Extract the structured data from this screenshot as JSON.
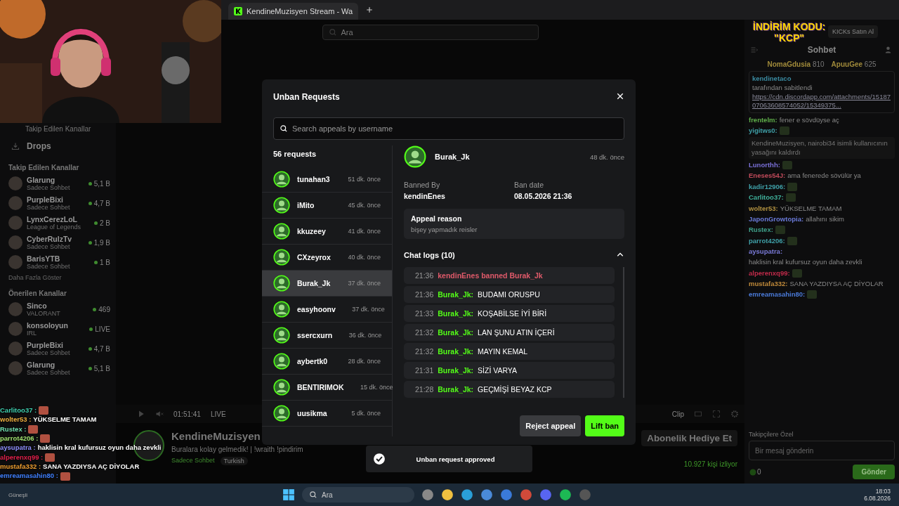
{
  "browser": {
    "tab_title": "KendineMuzisyen Stream - Wa"
  },
  "sidebar": {
    "top_header": "Takip Edilen Kanallar",
    "drops": "Drops",
    "sections": [
      {
        "title": "Takip Edilen Kanallar",
        "channels": [
          {
            "name": "Glarung",
            "category": "Sadece Sohbet",
            "viewers": "5,1 B"
          },
          {
            "name": "PurpleBixi",
            "category": "Sadece Sohbet",
            "viewers": "4,7 B"
          },
          {
            "name": "LynxCerezLoL",
            "category": "League of Legends",
            "viewers": "2 B"
          },
          {
            "name": "CyberRulzTv",
            "category": "Sadece Sohbet",
            "viewers": "1,9 B"
          },
          {
            "name": "BarisYTB",
            "category": "Sadece Sohbet",
            "viewers": "1 B"
          }
        ],
        "more": "Daha Fazla Göster"
      },
      {
        "title": "Önerilen Kanallar",
        "channels": [
          {
            "name": "Sinco",
            "category": "VALORANT",
            "viewers": "469"
          },
          {
            "name": "konsoloyun",
            "category": "IRL",
            "viewers": "LIVE"
          },
          {
            "name": "PurpleBixi",
            "category": "Sadece Sohbet",
            "viewers": "4,7 B"
          },
          {
            "name": "Glarung",
            "category": "Sadece Sohbet",
            "viewers": "5,1 B"
          }
        ]
      }
    ]
  },
  "stream": {
    "search_placeholder": "Ara",
    "kicks_button": "KICKs Satın Al",
    "elapsed": "01:51:41",
    "live": "LIVE",
    "clip": "Clip",
    "streamer": "KendineMuzisyen",
    "title": "Buralara kolay gelmedik! | !wraith !pindirim",
    "tags": [
      "Sadece Sohbet",
      "Turkish"
    ],
    "viewers": "10.927 kişi izliyor",
    "gift": "Abonelik Hediye Et"
  },
  "promo": {
    "line1": "İNDİRİM KODU:",
    "line2": "\"KCP\""
  },
  "chat": {
    "title": "Sohbet",
    "gifters": [
      {
        "name": "NomaGdusia",
        "count": "810"
      },
      {
        "name": "ApuuGee",
        "count": "625"
      }
    ],
    "pinned": {
      "user": "kendinetaco",
      "note": "tarafından sabitlendi",
      "link": "https://cdn.discordapp.com/attachments/1518707063608574052/15349375..."
    },
    "messages": [
      {
        "kind": "text",
        "user": "frentelm:",
        "color": "#5faf4a",
        "text": "fener e sövdüyse aç"
      },
      {
        "kind": "emote",
        "user": "yigitws0:",
        "color": "#3fa0a8"
      },
      {
        "kind": "system",
        "text": "KendineMuzisyen, nairobi34 isimli kullanıcının yasağını kaldırdı"
      },
      {
        "kind": "emote",
        "user": "Lunorthh:",
        "color": "#7a70d8"
      },
      {
        "kind": "text",
        "user": "Eneses54J:",
        "color": "#c04a5a",
        "text": "ama fenerede sövülür ya"
      },
      {
        "kind": "emote",
        "user": "kadir12906:",
        "color": "#3fa0a8"
      },
      {
        "kind": "emote",
        "user": "Carlitoo37:",
        "color": "#3fb09a"
      },
      {
        "kind": "text",
        "user": "wolter53:",
        "color": "#b09040",
        "text": "YÜKSELME TAMAM"
      },
      {
        "kind": "text",
        "user": "JaponGrowtopia:",
        "color": "#6a7ad8",
        "text": "allahını sikim"
      },
      {
        "kind": "emote",
        "user": "Rustex:",
        "color": "#3fa08a"
      },
      {
        "kind": "emote",
        "user": "parrot4206:",
        "color": "#3fa0a8"
      },
      {
        "kind": "text",
        "user": "aysupatra:",
        "color": "#7a7ad8",
        "text": "haklisin kral kufursuz oyun daha zevkli"
      },
      {
        "kind": "emote",
        "user": "alperenxq99:",
        "color": "#c02a4a"
      },
      {
        "kind": "text",
        "user": "mustafa332:",
        "color": "#c08a3a",
        "text": "SANA YAZDIYSA AÇ DİYOLAR"
      },
      {
        "kind": "emote",
        "user": "emreamasahin80:",
        "color": "#4a7ad8"
      }
    ],
    "followers_label": "Takipçilere Özel",
    "input_placeholder": "Bir mesaj gönderin",
    "kicks_count": "0",
    "send": "Gönder"
  },
  "overlay_chat": [
    {
      "kind": "emote",
      "user": "Carlitoo37 :",
      "color": "#3fd0b0"
    },
    {
      "kind": "text",
      "user": "wolter53 :",
      "color": "#f0b040",
      "text": "YÜKSELME TAMAM"
    },
    {
      "kind": "emote",
      "user": "Rustex :",
      "color": "#70e0b0"
    },
    {
      "kind": "emote",
      "user": "parrot4206 :",
      "color": "#a0e070"
    },
    {
      "kind": "text",
      "user": "aysupatra :",
      "color": "#9090ff",
      "text": "haklisin kral kufursuz oyun daha zevkli"
    },
    {
      "kind": "emote",
      "user": "alperenxq99 :",
      "color": "#e0204a"
    },
    {
      "kind": "text",
      "user": "mustafa332 :",
      "color": "#f0a030",
      "text": "SANA YAZDIYSA AÇ DİYOLAR"
    },
    {
      "kind": "emote",
      "user": "emreamasahin80 :",
      "color": "#4080ff"
    }
  ],
  "modal": {
    "title": "Unban Requests",
    "search_placeholder": "Search appeals by username",
    "count": "56 requests",
    "requests": [
      {
        "user": "tunahan3",
        "time": "51 dk. önce",
        "selected": false
      },
      {
        "user": "iMito",
        "time": "45 dk. önce",
        "selected": false
      },
      {
        "user": "kkuzeey",
        "time": "41 dk. önce",
        "selected": false
      },
      {
        "user": "CXzeyrox",
        "time": "40 dk. önce",
        "selected": false
      },
      {
        "user": "Burak_Jk",
        "time": "37 dk. önce",
        "selected": true
      },
      {
        "user": "easyhoonv",
        "time": "37 dk. önce",
        "selected": false
      },
      {
        "user": "ssercxurn",
        "time": "36 dk. önce",
        "selected": false
      },
      {
        "user": "aybertk0",
        "time": "28 dk. önce",
        "selected": false
      },
      {
        "user": "BENTIRIMOK",
        "time": "15 dk. önce",
        "selected": false
      },
      {
        "user": "uusikma",
        "time": "5 dk. önce",
        "selected": false
      }
    ],
    "detail": {
      "user": "Burak_Jk",
      "time": "48 dk. önce",
      "banned_by_label": "Banned By",
      "banned_by": "kendinEnes",
      "ban_date_label": "Ban date",
      "ban_date": "08.05.2026 21:36",
      "reason_label": "Appeal reason",
      "reason": "bişey yapmadık reisler",
      "logs_title": "Chat logs (10)",
      "logs_expanded": true,
      "logs": [
        {
          "kind": "ban",
          "time": "21:36",
          "text": "kendinEnes banned Burak_Jk"
        },
        {
          "kind": "message",
          "time": "21:36",
          "user": "Burak_Jk:",
          "text": "BUDAMI ORUSPU"
        },
        {
          "kind": "message",
          "time": "21:33",
          "user": "Burak_Jk:",
          "text": "KOŞABİLSE İYİ BİRİ"
        },
        {
          "kind": "message",
          "time": "21:32",
          "user": "Burak_Jk:",
          "text": "LAN ŞUNU ATIN İÇERİ"
        },
        {
          "kind": "message",
          "time": "21:32",
          "user": "Burak_Jk:",
          "text": "MAYIN KEMAL"
        },
        {
          "kind": "message",
          "time": "21:31",
          "user": "Burak_Jk:",
          "text": "SİZİ VARYA"
        },
        {
          "kind": "message",
          "time": "21:28",
          "user": "Burak_Jk:",
          "text": "GEÇMİŞİ BEYAZ KCP"
        }
      ]
    },
    "reject": "Reject appeal",
    "lift": "Lift ban"
  },
  "toast": "Unban request approved",
  "taskbar": {
    "weather": "Güneşli",
    "search": "Ara",
    "time": "18:03",
    "date": "6.08.2026"
  }
}
